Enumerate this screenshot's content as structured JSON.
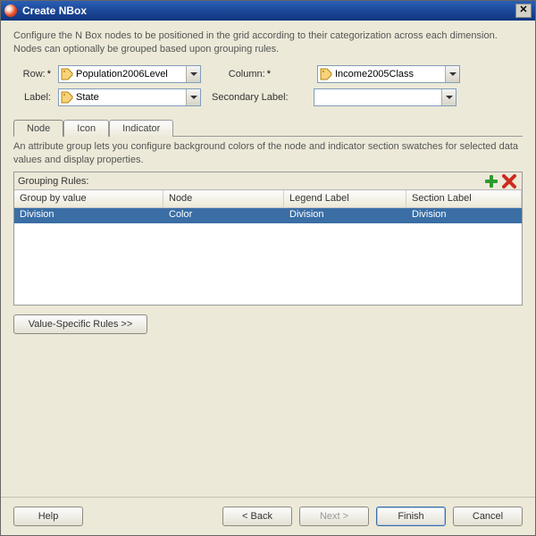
{
  "window": {
    "title": "Create NBox"
  },
  "intro": "Configure the N Box nodes to be positioned in the grid according to their categorization across each dimension. Nodes can optionally be grouped based upon grouping rules.",
  "form": {
    "row_label": "Row:",
    "row_value": "Population2006Level",
    "column_label": "Column:",
    "column_value": "Income2005Class",
    "label_label": "Label:",
    "label_value": "State",
    "seclabel_label": "Secondary Label:",
    "seclabel_value": ""
  },
  "tabs": {
    "node": "Node",
    "icon": "Icon",
    "indicator": "Indicator"
  },
  "tabdesc": "An attribute group lets you configure background colors of the node and indicator section swatches for selected data values and display properties.",
  "grouping": {
    "title": "Grouping Rules:",
    "headers": {
      "groupby": "Group by value",
      "node": "Node",
      "legend": "Legend Label",
      "section": "Section Label"
    },
    "rows": [
      {
        "groupby": "Division",
        "node": "Color",
        "legend": "Division",
        "section": "Division"
      }
    ]
  },
  "vsr_button": "Value-Specific Rules >>",
  "footer": {
    "help": "Help",
    "back": "Back",
    "next": "Next",
    "finish": "Finish",
    "cancel": "Cancel"
  }
}
